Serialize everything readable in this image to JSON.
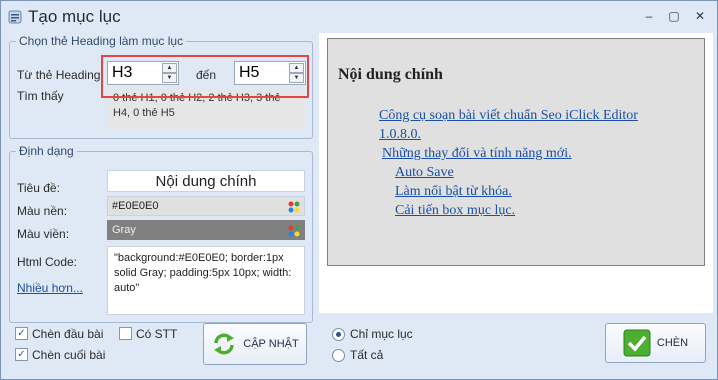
{
  "window": {
    "title": "Tạo mục lục",
    "minimize": "–",
    "maximize": "▢",
    "close": "✕"
  },
  "heading_group": {
    "legend": "Chọn thẻ Heading làm mục lục",
    "from_label": "Từ thẻ Heading",
    "from_value": "H3",
    "to_label": "đến",
    "to_value": "H5",
    "found_label": "Tìm thấy",
    "found_text": "0 thẻ H1, 0 thẻ H2, 2 thẻ H3, 3 thẻ H4, 0 thẻ H5"
  },
  "format_group": {
    "legend": "Định dạng",
    "title_label": "Tiêu đề:",
    "title_value": "Nội dung chính",
    "bg_label": "Màu nền:",
    "bg_value": "#E0E0E0",
    "border_label": "Màu viền:",
    "border_value": "Gray",
    "html_label": "Html Code:",
    "html_value": "\"background:#E0E0E0; border:1px solid Gray; padding:5px 10px; width: auto\"",
    "more_link": "Nhiều hơn..."
  },
  "options": {
    "insert_top": "Chèn đầu bài",
    "insert_top_checked": true,
    "insert_bottom": "Chèn cuối bài",
    "insert_bottom_checked": true,
    "has_stt": "Có STT",
    "has_stt_checked": false,
    "update_button": "CẬP NHẬT"
  },
  "preview": {
    "title": "Nội dung chính",
    "items": [
      {
        "text": "Công cụ soạn bài viết chuẩn Seo iClick Editor 1.0.8.0.",
        "level": 1
      },
      {
        "text": "Những thay đổi và tính năng mới.",
        "level": 1
      },
      {
        "text": "Auto Save",
        "level": 2
      },
      {
        "text": "Làm nổi bật từ khóa.",
        "level": 2
      },
      {
        "text": "Cải tiến box mục lục.",
        "level": 2
      }
    ]
  },
  "bottom": {
    "radio_toc_only": "Chỉ mục lục",
    "radio_all": "Tất cả",
    "selected": "toc_only",
    "insert_button": "CHÈN"
  },
  "colors": {
    "window_bg": "#dfe9f5",
    "preview_bg": "#E0E0E0",
    "border_gray": "#808080",
    "link_blue": "#1a4fa3",
    "highlight_red": "#e04848",
    "button_green": "#4caf2f"
  }
}
